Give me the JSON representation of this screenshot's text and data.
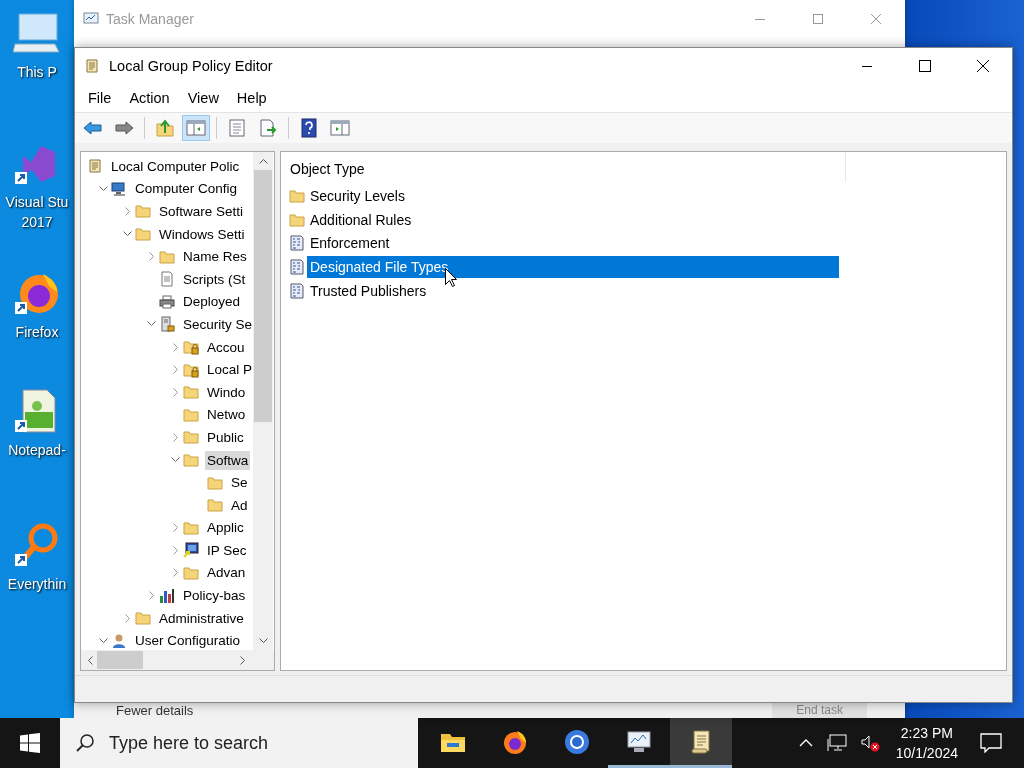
{
  "desktop_icons": [
    {
      "kind": "pc",
      "lines": [
        "This P"
      ]
    },
    {
      "kind": "vs",
      "lines": [
        "Visual Stu",
        "2017"
      ]
    },
    {
      "kind": "firefox",
      "lines": [
        "Firefox"
      ]
    },
    {
      "kind": "notepad",
      "lines": [
        "Notepad-"
      ]
    },
    {
      "kind": "everything",
      "lines": [
        "Everythin"
      ]
    }
  ],
  "task_manager": {
    "title": "Task Manager",
    "footer_link": "Fewer details",
    "button": "End task"
  },
  "window": {
    "title": "Local Group Policy Editor"
  },
  "menu": [
    "File",
    "Action",
    "View",
    "Help"
  ],
  "toolbar": [
    {
      "kind": "back",
      "pressed": false
    },
    {
      "kind": "forward",
      "pressed": false
    },
    {
      "kind": "sep"
    },
    {
      "kind": "up",
      "pressed": false
    },
    {
      "kind": "tree",
      "pressed": true
    },
    {
      "kind": "sep"
    },
    {
      "kind": "properties",
      "pressed": false
    },
    {
      "kind": "export",
      "pressed": false
    },
    {
      "kind": "sep"
    },
    {
      "kind": "help",
      "pressed": false
    },
    {
      "kind": "pane",
      "pressed": false
    }
  ],
  "tree": [
    {
      "label": "Local Computer Polic",
      "kind": "policy",
      "chevron": false,
      "selected": false,
      "children": [
        {
          "label": "Computer Config",
          "kind": "computer",
          "chevron": true,
          "expanded": true,
          "selected": false,
          "children": [
            {
              "label": "Software Setti",
              "kind": "folder",
              "chevron": true,
              "expanded": false,
              "selected": false
            },
            {
              "label": "Windows Setti",
              "kind": "folder",
              "chevron": true,
              "expanded": true,
              "selected": false,
              "children": [
                {
                  "label": "Name Res",
                  "kind": "folder",
                  "chevron": true,
                  "expanded": false,
                  "selected": false
                },
                {
                  "label": "Scripts (St",
                  "kind": "script",
                  "chevron": false,
                  "selected": false
                },
                {
                  "label": "Deployed",
                  "kind": "printer",
                  "chevron": false,
                  "selected": false
                },
                {
                  "label": "Security Se",
                  "kind": "security",
                  "chevron": true,
                  "expanded": true,
                  "selected": false,
                  "children": [
                    {
                      "label": "Accou",
                      "kind": "folder-lock",
                      "chevron": true,
                      "expanded": false,
                      "selected": false
                    },
                    {
                      "label": "Local P",
                      "kind": "folder-lock",
                      "chevron": true,
                      "expanded": false,
                      "selected": false
                    },
                    {
                      "label": "Windo",
                      "kind": "folder",
                      "chevron": true,
                      "expanded": false,
                      "selected": false
                    },
                    {
                      "label": "Netwo",
                      "kind": "folder",
                      "chevron": false,
                      "selected": false
                    },
                    {
                      "label": "Public",
                      "kind": "folder",
                      "chevron": true,
                      "expanded": false,
                      "selected": false
                    },
                    {
                      "label": "Softwa",
                      "kind": "folder",
                      "chevron": true,
                      "expanded": true,
                      "selected": true,
                      "children": [
                        {
                          "label": "Se",
                          "kind": "folder",
                          "chevron": false,
                          "selected": false
                        },
                        {
                          "label": "Ad",
                          "kind": "folder",
                          "chevron": false,
                          "selected": false
                        }
                      ]
                    },
                    {
                      "label": "Applic",
                      "kind": "folder",
                      "chevron": true,
                      "expanded": false,
                      "selected": false
                    },
                    {
                      "label": "IP Sec",
                      "kind": "ipsec",
                      "chevron": true,
                      "expanded": false,
                      "selected": false
                    },
                    {
                      "label": "Advan",
                      "kind": "folder",
                      "chevron": true,
                      "expanded": false,
                      "selected": false
                    }
                  ]
                },
                {
                  "label": "Policy-bas",
                  "kind": "chart",
                  "chevron": true,
                  "expanded": false,
                  "selected": false
                }
              ]
            },
            {
              "label": "Administrative",
              "kind": "folder",
              "chevron": true,
              "expanded": false,
              "selected": false
            }
          ]
        },
        {
          "label": "User Configuratio",
          "kind": "user",
          "chevron": true,
          "expanded": true,
          "selected": false
        }
      ]
    }
  ],
  "list": {
    "column": "Object Type",
    "items": [
      {
        "label": "Security Levels",
        "kind": "folder",
        "selected": false
      },
      {
        "label": "Additional Rules",
        "kind": "folder",
        "selected": false
      },
      {
        "label": "Enforcement",
        "kind": "binary",
        "selected": false
      },
      {
        "label": "Designated File Types",
        "kind": "binary",
        "selected": true
      },
      {
        "label": "Trusted Publishers",
        "kind": "binary",
        "selected": false
      }
    ]
  },
  "taskbar": {
    "search": {
      "placeholder": "Type here to search"
    },
    "apps": [
      {
        "kind": "explorer",
        "running": false,
        "active": false
      },
      {
        "kind": "firefox",
        "running": false,
        "active": false
      },
      {
        "kind": "chrome",
        "running": false,
        "active": false
      },
      {
        "kind": "taskmgr",
        "running": true,
        "active": false
      },
      {
        "kind": "gpedit",
        "running": true,
        "active": true
      }
    ],
    "time": "2:23 PM",
    "date": "10/1/2024"
  }
}
